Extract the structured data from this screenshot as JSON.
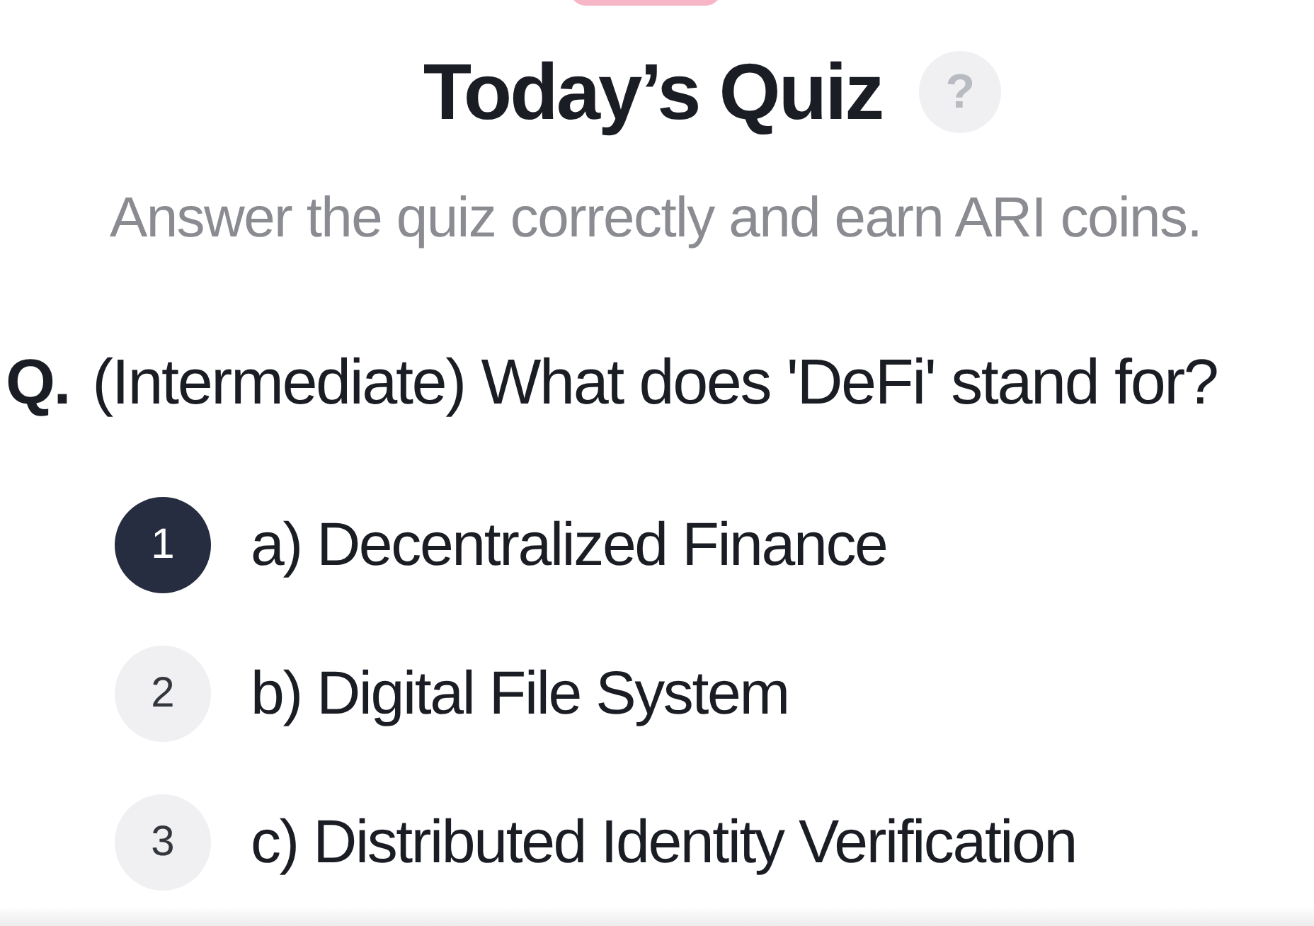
{
  "title": "Today’s Quiz",
  "help_icon": "?",
  "subtitle": "Answer the quiz correctly and earn ARI coins.",
  "question": {
    "prefix": "Q.",
    "text": "(Intermediate) What does 'DeFi' stand for?"
  },
  "options": [
    {
      "number": "1",
      "label": "a) Decentralized Finance",
      "selected": true
    },
    {
      "number": "2",
      "label": "b) Digital File System",
      "selected": false
    },
    {
      "number": "3",
      "label": "c) Distributed Identity Verification",
      "selected": false
    }
  ]
}
